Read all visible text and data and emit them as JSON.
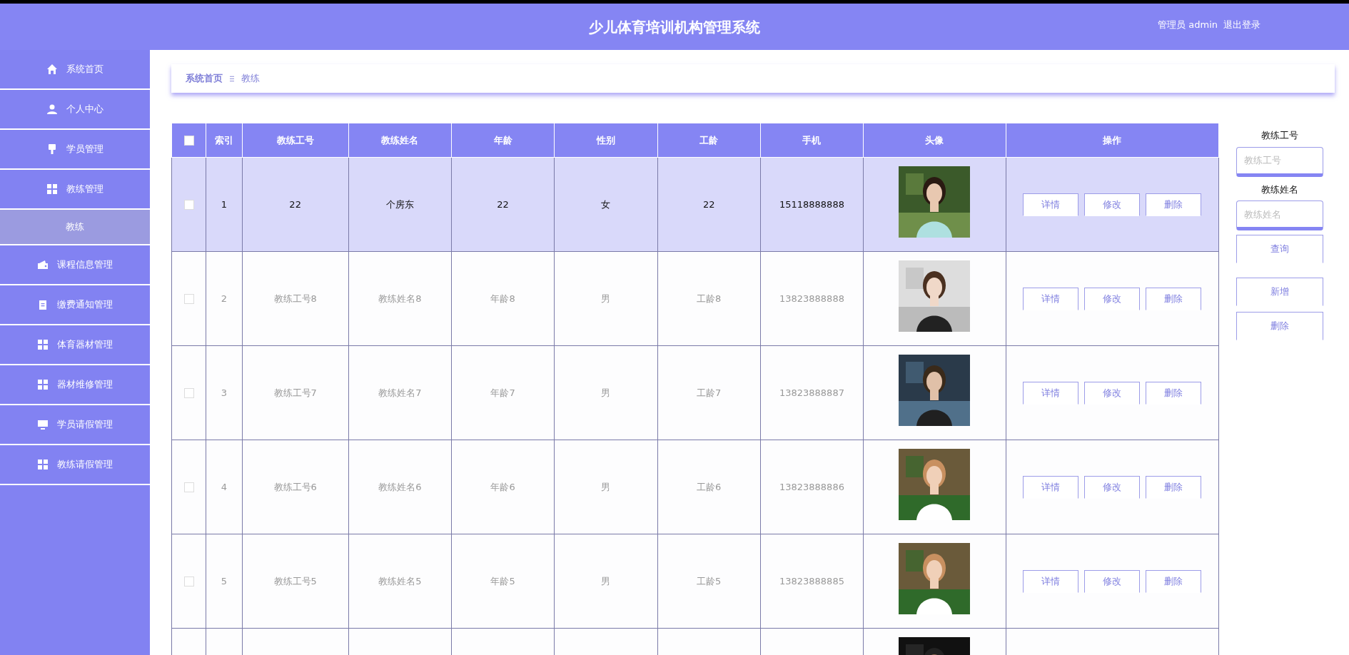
{
  "header": {
    "title": "少儿体育培训机构管理系统",
    "user": "管理员 admin",
    "logout": "退出登录"
  },
  "sidebar": {
    "items": [
      {
        "label": "系统首页",
        "kind": "group",
        "selected": false
      },
      {
        "label": "个人中心",
        "kind": "group",
        "selected": false
      },
      {
        "label": "学员管理",
        "kind": "group",
        "selected": false
      },
      {
        "label": "教练管理",
        "kind": "group",
        "selected": false
      },
      {
        "label": "教练",
        "kind": "sub",
        "selected": true
      },
      {
        "label": "课程信息管理",
        "kind": "group",
        "selected": false
      },
      {
        "label": "缴费通知管理",
        "kind": "group",
        "selected": false
      },
      {
        "label": "体育器材管理",
        "kind": "group",
        "selected": false
      },
      {
        "label": "器材维修管理",
        "kind": "group",
        "selected": false
      },
      {
        "label": "学员请假管理",
        "kind": "group",
        "selected": false
      },
      {
        "label": "教练请假管理",
        "kind": "group",
        "selected": false
      }
    ]
  },
  "breadcrumb": [
    "系统首页",
    "教练"
  ],
  "table": {
    "select_all": {
      "checked": false
    },
    "columns": [
      "索引",
      "教练工号",
      "教练姓名",
      "年龄",
      "性别",
      "工龄",
      "手机",
      "头像",
      "操作"
    ],
    "rows": [
      {
        "selected": true,
        "checked": false,
        "cells": [
          "1",
          "22",
          "个房东",
          "22",
          "女",
          "22",
          "15118888888"
        ],
        "avatar": {
          "kind": "picture"
        },
        "actions": [
          "详情",
          "修改",
          "删除"
        ]
      },
      {
        "selected": false,
        "checked": false,
        "cells": [
          "2",
          "教练工号8",
          "教练姓名8",
          "年龄8",
          "男",
          "工龄8",
          "13823888888"
        ],
        "avatar": {
          "kind": "picture"
        },
        "actions": [
          "详情",
          "修改",
          "删除"
        ]
      },
      {
        "selected": false,
        "checked": false,
        "cells": [
          "3",
          "教练工号7",
          "教练姓名7",
          "年龄7",
          "男",
          "工龄7",
          "13823888887"
        ],
        "avatar": {
          "kind": "picture"
        },
        "actions": [
          "详情",
          "修改",
          "删除"
        ]
      },
      {
        "selected": false,
        "checked": false,
        "cells": [
          "4",
          "教练工号6",
          "教练姓名6",
          "年龄6",
          "男",
          "工龄6",
          "13823888886"
        ],
        "avatar": {
          "kind": "picture"
        },
        "actions": [
          "详情",
          "修改",
          "删除"
        ]
      },
      {
        "selected": false,
        "checked": false,
        "cells": [
          "5",
          "教练工号5",
          "教练姓名5",
          "年龄5",
          "男",
          "工龄5",
          "13823888885"
        ],
        "avatar": {
          "kind": "picture"
        },
        "actions": [
          "详情",
          "修改",
          "删除"
        ]
      },
      {
        "avatar": {
          "kind": "picture"
        }
      }
    ]
  },
  "search_panel": {
    "fields": [
      {
        "label": "教练工号",
        "placeholder": "教练工号"
      },
      {
        "label": "教练姓名",
        "placeholder": "教练姓名"
      }
    ],
    "query_button": "查询",
    "buttons": [
      "新增",
      "删除"
    ]
  }
}
